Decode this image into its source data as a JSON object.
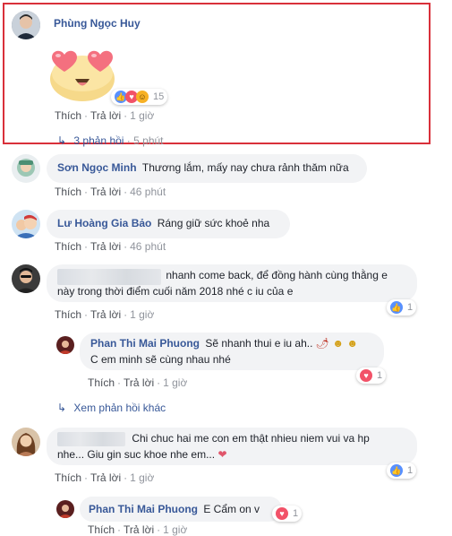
{
  "comments": [
    {
      "name": "Phùng Ngọc Huy",
      "reactions_count": "15",
      "actions": {
        "like": "Thích",
        "reply": "Trả lời",
        "time": "1 giờ"
      },
      "replies_link": "3 phản hồi",
      "replies_time": "5 phút"
    },
    {
      "name": "Sơn Ngọc Minh",
      "text": "Thương lắm, mấy nay chưa rảnh thăm nữa",
      "actions": {
        "like": "Thích",
        "reply": "Trả lời",
        "time": "46 phút"
      }
    },
    {
      "name": "Lư Hoàng Gia Bảo",
      "text": "Ráng giữ sức khoẻ nha",
      "actions": {
        "like": "Thích",
        "reply": "Trả lời",
        "time": "46 phút"
      }
    },
    {
      "text_line1": "nhanh come back, để đồng hành cùng thằng e",
      "text_line2": "này trong thời điểm cuối năm 2018 nhé c iu của e",
      "reactions_count": "1",
      "actions": {
        "like": "Thích",
        "reply": "Trả lời",
        "time": "1 giờ"
      },
      "reply": {
        "name": "Phan Thi Mai Phuong",
        "text_line1": "Sẽ nhanh thui e iu ah..",
        "text_line2": "C em minh sẽ cùng nhau nhé",
        "reactions_count": "1",
        "actions": {
          "like": "Thích",
          "reply": "Trả lời",
          "time": "1 giờ"
        }
      },
      "more_replies": "Xem phản hồi khác"
    },
    {
      "text_line1": "Chi chuc hai me con em thật nhieu niem vui va hp",
      "text_line2": "nhe... Giu gin suc khoe nhe em...",
      "reactions_count": "1",
      "actions": {
        "like": "Thích",
        "reply": "Trả lời",
        "time": "1 giờ"
      },
      "reply": {
        "name": "Phan Thi Mai Phuong",
        "text": "E Cẩm on v",
        "reactions_count": "1",
        "actions": {
          "like": "Thích",
          "reply": "Trả lời",
          "time": "1 giờ"
        }
      }
    }
  ],
  "colors": {
    "highlight_border": "#d9303a",
    "name_blue": "#385898",
    "bubble": "#f2f3f5"
  }
}
